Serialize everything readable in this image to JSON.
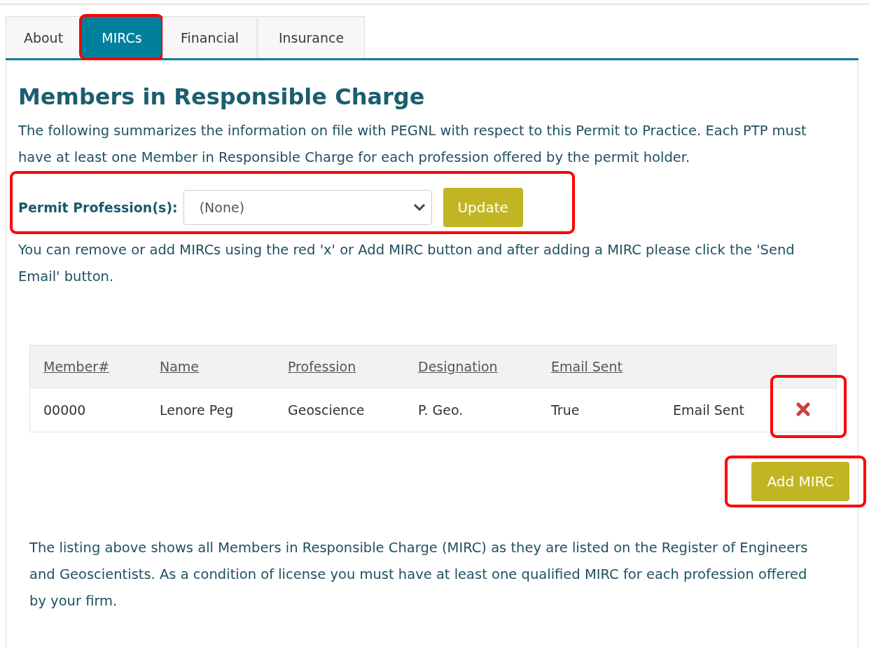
{
  "tabs": [
    {
      "label": "About",
      "selected": false,
      "highlighted": false
    },
    {
      "label": "MIRCs",
      "selected": true,
      "highlighted": true
    },
    {
      "label": "Financial",
      "selected": false,
      "highlighted": false
    },
    {
      "label": "Insurance",
      "selected": false,
      "highlighted": false
    }
  ],
  "heading": "Members in Responsible Charge",
  "intro": "The following summarizes the information on file with PEGNL with respect to this Permit to Practice. Each PTP must have at least one Member in Responsible Charge for each profession offered by the permit holder.",
  "profession_filter": {
    "label": "Permit Profession(s):",
    "value": "(None)",
    "button": "Update",
    "highlighted": true
  },
  "instructions": "You can remove or add MIRCs using the red 'x' or Add MIRC button and after adding a MIRC please click the 'Send Email' button.",
  "table": {
    "columns": [
      "Member#",
      "Name",
      "Profession",
      "Designation",
      "Email Sent"
    ],
    "rows": [
      {
        "cells": [
          "00000",
          "Lenore Peg",
          "Geoscience",
          "P. Geo.",
          "True",
          "Email Sent"
        ],
        "delete_highlighted": true
      }
    ]
  },
  "add_button": {
    "label": "Add MIRC",
    "highlighted": true
  },
  "footer": "The listing above shows all Members in Responsible Charge (MIRC) as they are listed on the Register of Engineers and Geoscientists. As a condition of license you must have at least one qualified MIRC for each profession offered by your firm."
}
